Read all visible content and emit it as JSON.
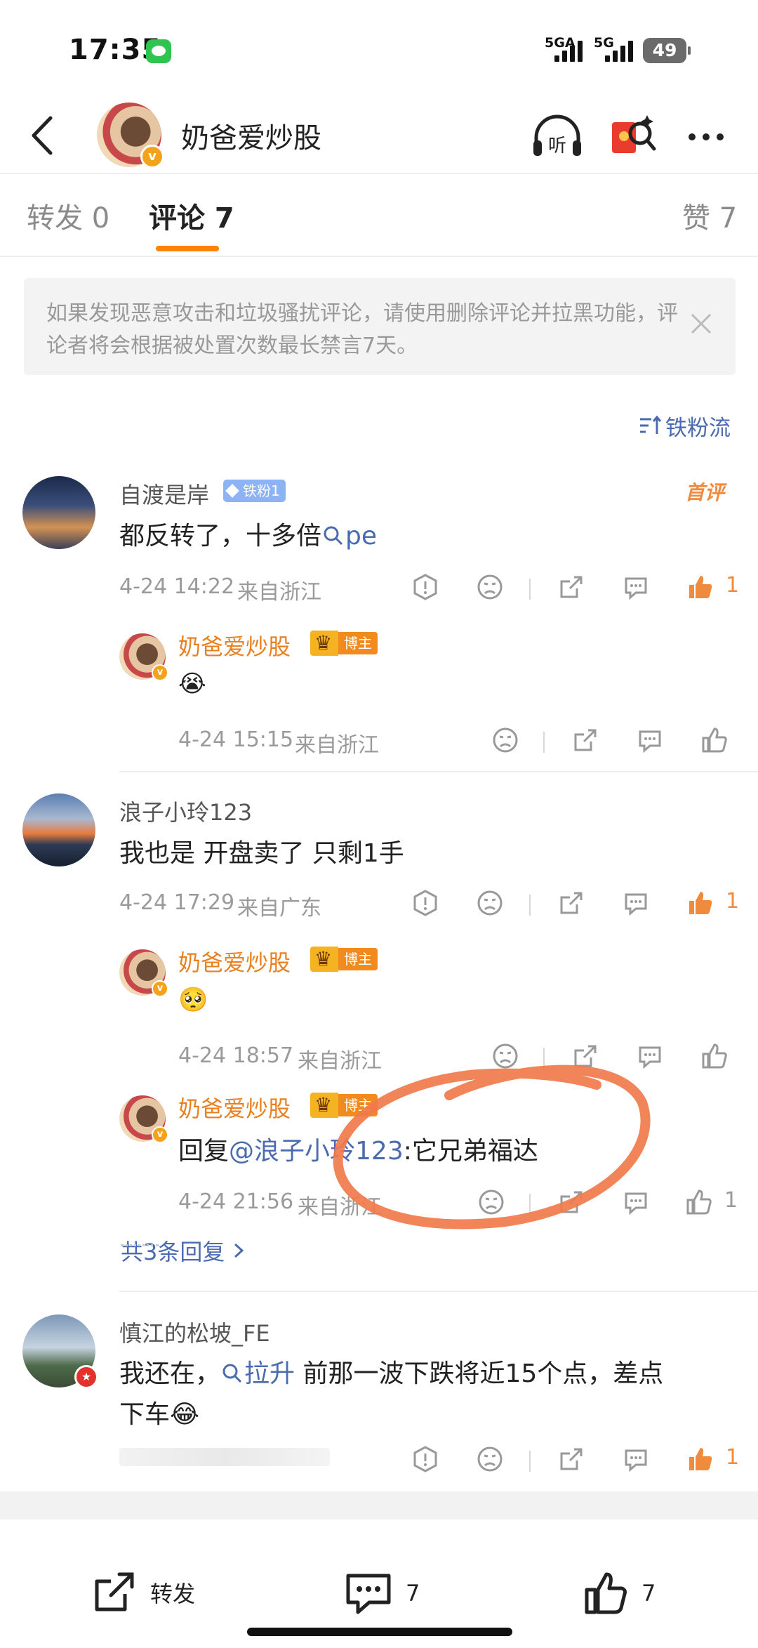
{
  "status_bar": {
    "time": "17:35",
    "sim1": "5GA",
    "sim2": "5G",
    "battery": "49"
  },
  "header": {
    "title": "奶爸爱炒股",
    "listen_label": "听"
  },
  "tabs": [
    {
      "label": "转发 0"
    },
    {
      "label": "评论 7"
    },
    {
      "label": "赞 7"
    }
  ],
  "notice": {
    "text": "如果发现恶意攻击和垃圾骚扰评论，请使用删除评论并拉黑功能，评论者将会根据被处置次数最长禁言7天。"
  },
  "sort": {
    "label": "铁粉流"
  },
  "comments": [
    {
      "user": "自渡是岸",
      "badge": "铁粉1",
      "tag": "首评",
      "text_main": "都反转了，十多倍",
      "text_link": "pe",
      "time": "4-24 14:22",
      "location": "来自浙江",
      "likes": "1",
      "replies": [
        {
          "user": "奶爸爱炒股",
          "badge": "博主",
          "emoji": "😭",
          "time": "4-24 15:15",
          "location": "来自浙江"
        }
      ]
    },
    {
      "user": "浪子小玲123",
      "text_main": "我也是 开盘卖了 只剩1手",
      "time": "4-24 17:29",
      "location": "来自广东",
      "likes": "1",
      "replies": [
        {
          "user": "奶爸爱炒股",
          "badge": "博主",
          "emoji": "🥺",
          "time": "4-24 18:57",
          "location": "来自浙江"
        },
        {
          "user": "奶爸爱炒股",
          "badge": "博主",
          "reply_prefix": "回复",
          "reply_mention": "@浪子小玲123",
          "reply_text": ":它兄弟福达",
          "time": "4-24 21:56",
          "location": "来自浙江",
          "likes": "1"
        }
      ],
      "more_replies": "共3条回复"
    },
    {
      "user": "慎江的松坡_FE",
      "text_pre": "我还在，",
      "text_link": "拉升",
      "text_post_line1": " 前那一波下跌将近15个点，差点",
      "text_line2": "下车",
      "emoji": "😂",
      "likes": "1"
    }
  ],
  "bottom_bar": {
    "repost_label": "转发",
    "comment_count": "7",
    "like_count": "7"
  },
  "colors": {
    "accent_orange": "#ff8200",
    "link_blue": "#4a6bb0",
    "annotation": "#f07a4a"
  },
  "icons": [
    "back-icon",
    "listen-icon",
    "red-packet-icon",
    "more-icon",
    "close-icon",
    "sort-icon",
    "report-icon",
    "dislike-icon",
    "share-icon",
    "comment-icon",
    "like-icon",
    "search-icon"
  ]
}
